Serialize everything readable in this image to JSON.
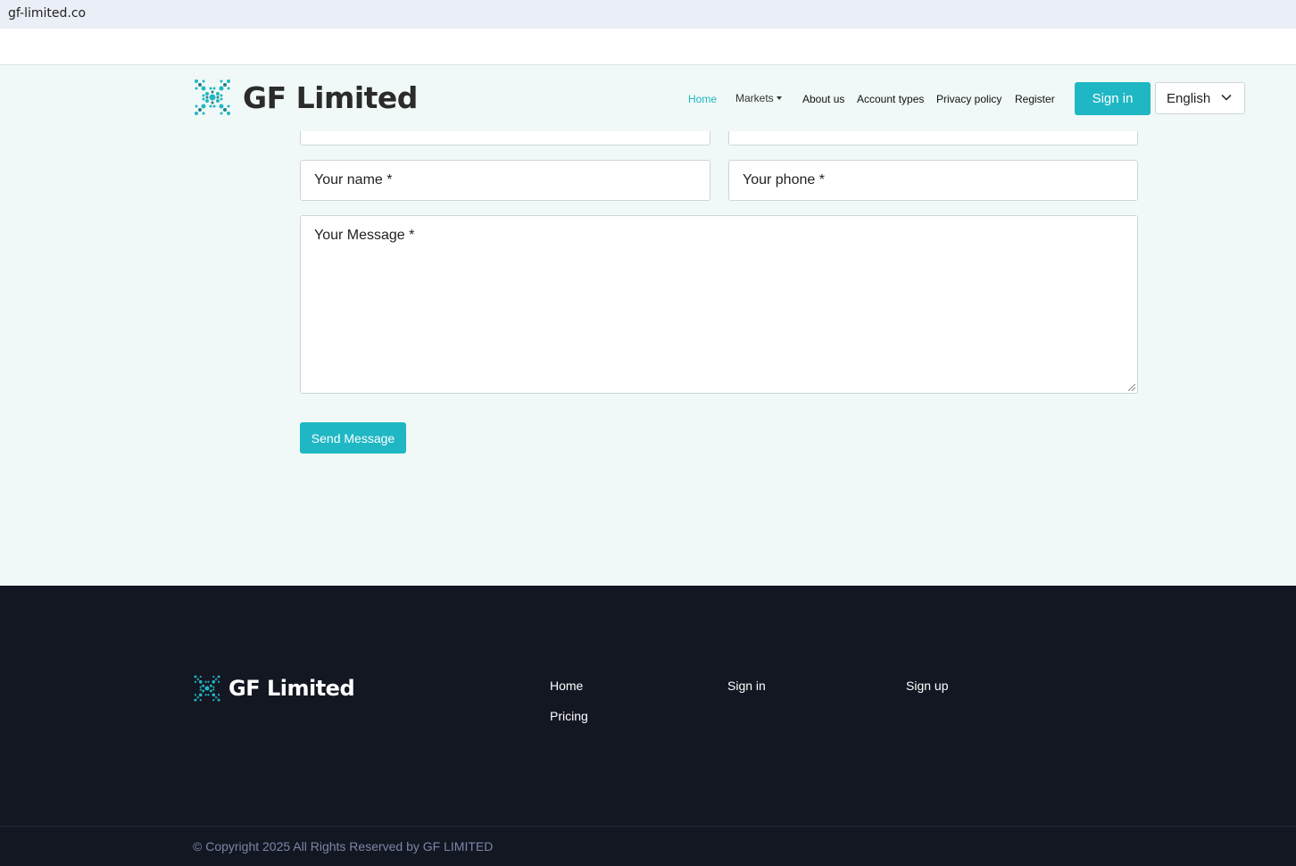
{
  "browser": {
    "url": "gf-limited.co"
  },
  "header": {
    "brand": "GF Limited",
    "nav": {
      "home": "Home",
      "markets": "Markets",
      "about": "About us",
      "account_types": "Account types",
      "privacy": "Privacy policy",
      "register": "Register"
    },
    "sign_in": "Sign in",
    "language": "English"
  },
  "form": {
    "name_placeholder": "Your name *",
    "phone_placeholder": "Your phone *",
    "message_placeholder": "Your Message *",
    "send_label": "Send Message"
  },
  "footer": {
    "brand": "GF Limited",
    "links": {
      "home": "Home",
      "pricing": "Pricing",
      "sign_in": "Sign in",
      "sign_up": "Sign up"
    },
    "copyright": "© Copyright 2025 All Rights Reserved by GF LIMITED"
  },
  "colors": {
    "accent": "#1fb7c4",
    "page_bg": "#f0f9f7",
    "footer_bg": "#131722"
  }
}
